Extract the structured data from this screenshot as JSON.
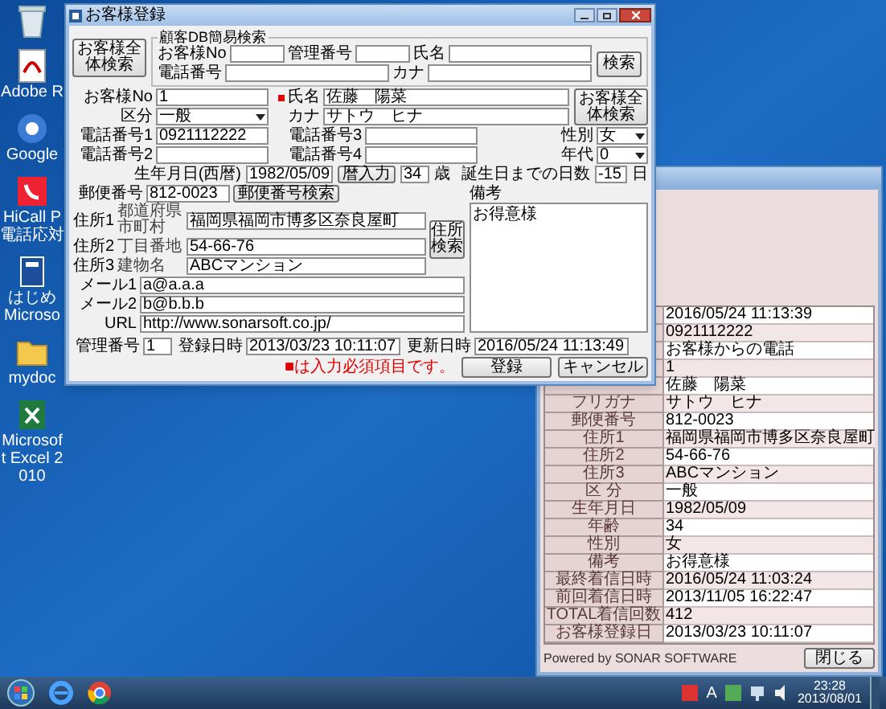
{
  "desktop_icons": [
    {
      "kind": "trash"
    },
    {
      "kind": "pdf",
      "label": "Adobe R"
    },
    {
      "kind": "browser",
      "label": "Google"
    },
    {
      "kind": "phone",
      "label": "HiCall P 電話応対"
    },
    {
      "kind": "book",
      "label": "はじめ Microso"
    },
    {
      "kind": "folder",
      "label": "mydoc"
    },
    {
      "kind": "excel",
      "label": "Microsoft Excel 2010"
    }
  ],
  "main_window": {
    "title": "お客様登録",
    "all_search_button": "お客様全体検索",
    "quick_search": {
      "title": "顧客DB簡易検索",
      "fields": [
        {
          "label": "お客様No"
        },
        {
          "label": "管理番号"
        },
        {
          "label": "氏名"
        },
        {
          "label": "電話番号"
        },
        {
          "label": "カナ"
        }
      ],
      "button": "検索"
    },
    "customer_no": {
      "label": "お客様No",
      "value": "1"
    },
    "name": {
      "label": "氏名",
      "value": "佐藤　陽菜",
      "required": true
    },
    "name_search_button": "お客様全体検索",
    "category": {
      "label": "区分",
      "value": "一般"
    },
    "kana": {
      "label": "カナ",
      "value": "サトウ　ヒナ"
    },
    "phones": [
      {
        "label": "電話番号1",
        "value": "0921112222"
      },
      {
        "label": "電話番号3"
      },
      {
        "label": "電話番号2"
      },
      {
        "label": "電話番号4"
      }
    ],
    "gender": {
      "label": "性別",
      "value": "女"
    },
    "age_group": {
      "label": "年代",
      "value": "0"
    },
    "birthday": {
      "label": "生年月日(西暦)",
      "value": "1982/05/09",
      "calendar_button": "暦入力",
      "age": "34",
      "age_unit": "歳",
      "days_label": "誕生日までの日数",
      "days": "-15",
      "days_unit": "日"
    },
    "postal": {
      "label": "郵便番号",
      "value": "812-0023",
      "button": "郵便番号検索"
    },
    "addresses": [
      {
        "label": "住所1",
        "sublabel": "都道府県市町村",
        "value": "福岡県福岡市博多区奈良屋町"
      },
      {
        "label": "住所2",
        "sublabel": "丁目番地",
        "value": "54-66-76"
      },
      {
        "label": "住所3",
        "sublabel": "建物名",
        "value": "ABCマンション"
      }
    ],
    "address_button": "住所検索",
    "memo": {
      "label": "備考",
      "value": "お得意様"
    },
    "contacts": [
      {
        "label": "メール1",
        "value": "a@a.a.a"
      },
      {
        "label": "メール2",
        "value": "b@b.b.b"
      },
      {
        "label": "URL",
        "value": "http://www.sonarsoft.co.jp/"
      }
    ],
    "meta": [
      {
        "label": "管理番号",
        "value": "1"
      },
      {
        "label": "登録日時",
        "value": "2013/03/23 10:11:07"
      },
      {
        "label": "更新日時",
        "value": "2016/05/24 11:13:49"
      }
    ],
    "required_note": "■は入力必須項目です。",
    "buttons": [
      "登録",
      "キャンセル"
    ]
  },
  "info_window": {
    "rows": [
      {
        "value": "2016/05/24 11:13:39"
      },
      {
        "value": "0921112222"
      },
      {
        "value": "お客様からの電話"
      },
      {
        "value": "1"
      },
      {
        "value": "佐藤　陽菜"
      },
      {
        "label": "フリガナ",
        "value": "サトウ　ヒナ"
      },
      {
        "label": "郵便番号",
        "value": "812-0023"
      },
      {
        "label": "住所1",
        "value": "福岡県福岡市博多区奈良屋町"
      },
      {
        "label": "住所2",
        "value": "54-66-76"
      },
      {
        "label": "住所3",
        "value": "ABCマンション"
      },
      {
        "label": "区 分",
        "value": "一般"
      },
      {
        "label": "生年月日",
        "value": "1982/05/09"
      },
      {
        "label": "年齢",
        "value": "34"
      },
      {
        "label": "性別",
        "value": "女"
      },
      {
        "label": "備考",
        "value": "お得意様"
      },
      {
        "label": "最終着信日時",
        "value": "2016/05/24 11:03:24"
      },
      {
        "label": "前回着信日時",
        "value": "2013/11/05 16:22:47"
      },
      {
        "label": "TOTAL着信回数",
        "value": "412"
      },
      {
        "label": "お客様登録日",
        "value": "2013/03/23 10:11:07"
      }
    ],
    "footer": "Powered by SONAR SOFTWARE",
    "close_button": "閉じる"
  },
  "taskbar": {
    "ime": "A",
    "time": "23:28",
    "date": "2013/08/01"
  }
}
